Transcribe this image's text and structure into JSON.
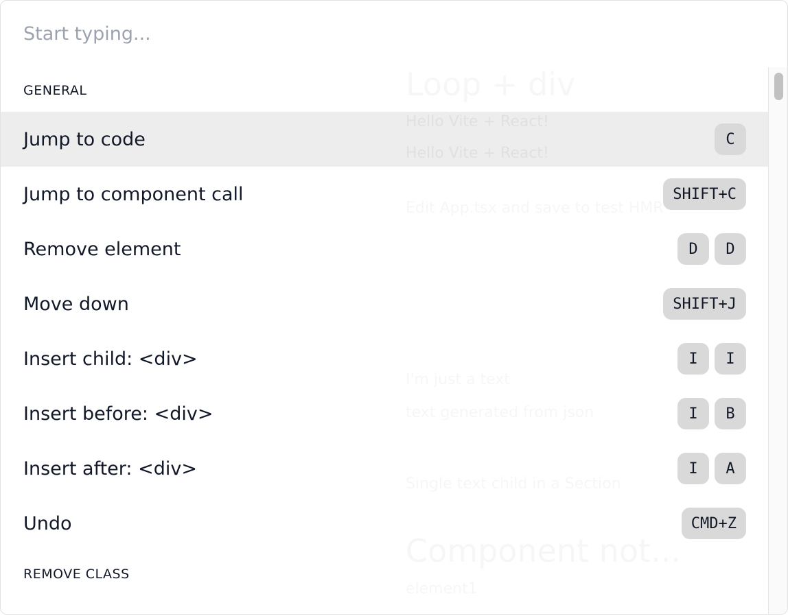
{
  "search": {
    "placeholder": "Start typing...",
    "value": ""
  },
  "background_text": [
    "Loop + div",
    "Hello Vite + React!",
    "Hello Vite + React!",
    "Edit App.tsx and save to test HMR",
    "I'm just a text",
    "text generated from json",
    "Single text child in a Section",
    "Component not...",
    "element1"
  ],
  "sections": [
    {
      "title": "GENERAL",
      "items": [
        {
          "label": "Jump to code",
          "keys": [
            "C"
          ],
          "active": true
        },
        {
          "label": "Jump to component call",
          "keys": [
            "SHIFT+C"
          ]
        },
        {
          "label": "Remove element",
          "keys": [
            "D",
            "D"
          ]
        },
        {
          "label": "Move down",
          "keys": [
            "SHIFT+J"
          ]
        },
        {
          "label": "Insert child: <div>",
          "keys": [
            "I",
            "I"
          ]
        },
        {
          "label": "Insert before: <div>",
          "keys": [
            "I",
            "B"
          ]
        },
        {
          "label": "Insert after: <div>",
          "keys": [
            "I",
            "A"
          ]
        },
        {
          "label": "Undo",
          "keys": [
            "CMD+Z"
          ]
        }
      ]
    },
    {
      "title": "REMOVE CLASS",
      "items": []
    }
  ]
}
